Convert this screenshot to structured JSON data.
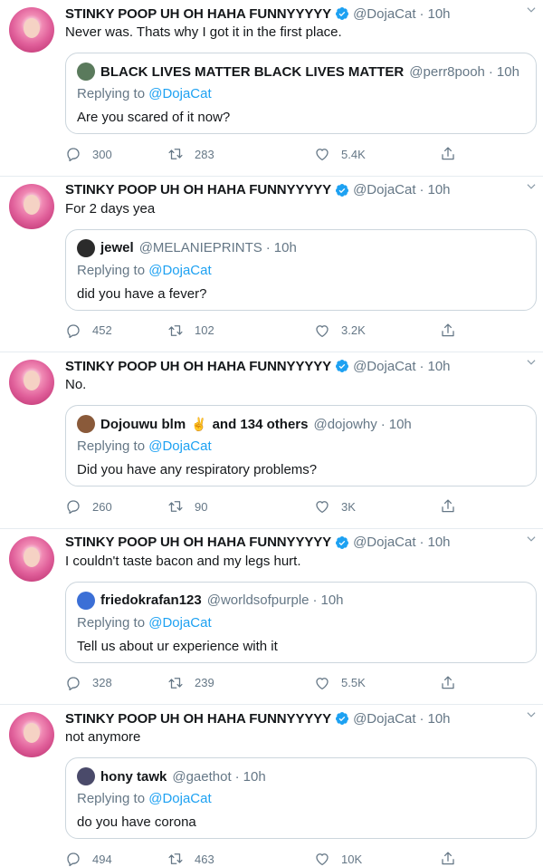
{
  "author": {
    "name": "STINKY POOP UH OH HAHA FUNNYYYYY",
    "handle": "@DojaCat",
    "time": "10h"
  },
  "reply_prefix": "Replying to ",
  "reply_mention": "@DojaCat",
  "colors": {
    "accent": "#1da1f2",
    "secondary_text": "#657786",
    "border": "#e6ecf0"
  },
  "tweets": [
    {
      "text": "Never was. Thats why I got it in the first place.",
      "quote": {
        "name": "BLACK LIVES MATTER BLACK LIVES MATTER",
        "handle": "@perr8pooh",
        "time": "10h",
        "text": "Are you scared of it now?"
      },
      "replies": "300",
      "retweets": "283",
      "likes": "5.4K"
    },
    {
      "text": "For 2 days yea",
      "quote": {
        "name": "jewel",
        "handle": "@MELANIEPRINTS",
        "time": "10h",
        "text": "did you have a fever?"
      },
      "replies": "452",
      "retweets": "102",
      "likes": "3.2K"
    },
    {
      "text": "No.",
      "quote": {
        "name": "Dojouwu blm",
        "emoji": "✌",
        "name_suffix": "and 134 others",
        "handle": "@dojowhy",
        "time": "10h",
        "text": "Did you have any respiratory problems?"
      },
      "replies": "260",
      "retweets": "90",
      "likes": "3K"
    },
    {
      "text": "I couldn't taste bacon and my legs hurt.",
      "quote": {
        "name": "friedokrafan123",
        "handle": "@worldsofpurple",
        "time": "10h",
        "text": "Tell us about ur experience with it"
      },
      "replies": "328",
      "retweets": "239",
      "likes": "5.5K"
    },
    {
      "text": "not anymore",
      "quote": {
        "name": "hony tawk",
        "handle": "@gaethot",
        "time": "10h",
        "text": "do you have corona"
      },
      "replies": "494",
      "retweets": "463",
      "likes": "10K"
    }
  ]
}
